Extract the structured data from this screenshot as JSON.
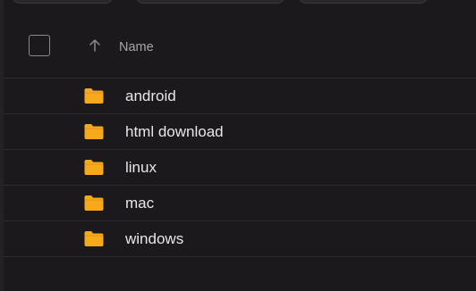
{
  "table": {
    "header": {
      "name_label": "Name"
    },
    "rows": [
      {
        "name": "android"
      },
      {
        "name": "html download"
      },
      {
        "name": "linux"
      },
      {
        "name": "mac"
      },
      {
        "name": "windows"
      }
    ]
  },
  "colors": {
    "background": "#1c191c",
    "folder": "#f5a91b",
    "text": "#e9e6ea",
    "header_text": "#a8a4a9"
  },
  "icons": {
    "sort": "arrow-up-icon",
    "folder": "folder-icon",
    "checkbox": "checkbox-icon"
  }
}
